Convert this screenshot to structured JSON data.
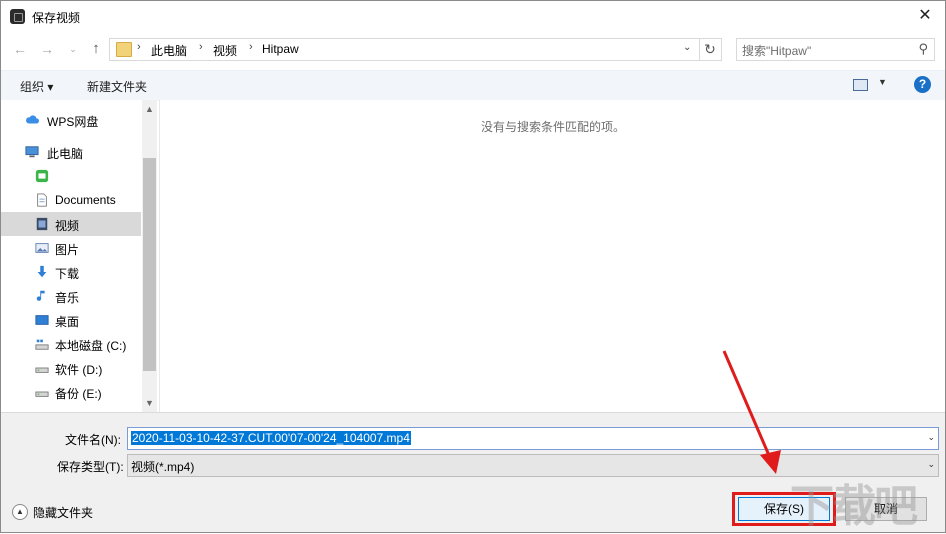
{
  "window": {
    "title": "保存视频"
  },
  "address": {
    "crumbs": [
      "此电脑",
      "视频",
      "Hitpaw"
    ],
    "search_placeholder": "搜索\"Hitpaw\""
  },
  "toolbar": {
    "organize": "组织 ▾",
    "new_folder": "新建文件夹"
  },
  "nav": {
    "items": [
      {
        "label": "WPS网盘",
        "icon": "cloud-icon"
      },
      {
        "label": "此电脑",
        "icon": "computer-icon"
      },
      {
        "label": "",
        "icon": "wifi-app-icon"
      },
      {
        "label": "Documents",
        "icon": "document-icon"
      },
      {
        "label": "视频",
        "icon": "video-icon",
        "selected": true
      },
      {
        "label": "图片",
        "icon": "picture-icon"
      },
      {
        "label": "下载",
        "icon": "download-icon"
      },
      {
        "label": "音乐",
        "icon": "music-icon"
      },
      {
        "label": "桌面",
        "icon": "desktop-icon"
      },
      {
        "label": "本地磁盘 (C:)",
        "icon": "drive-c-icon"
      },
      {
        "label": "软件 (D:)",
        "icon": "drive-icon"
      },
      {
        "label": "备份 (E:)",
        "icon": "drive-icon"
      }
    ]
  },
  "content": {
    "empty_message": "没有与搜索条件匹配的项。"
  },
  "form": {
    "filename_label": "文件名(N):",
    "filename_value": "2020-11-03-10-42-37.CUT.00'07-00'24_104007.mp4",
    "filetype_label": "保存类型(T):",
    "filetype_value": "视频(*.mp4)"
  },
  "footer": {
    "hide_folders": "隐藏文件夹",
    "save": "保存(S)",
    "cancel": "取消"
  },
  "colors": {
    "accent": "#0078d7",
    "annotation": "#e01b1b",
    "help": "#1a6fc6"
  }
}
